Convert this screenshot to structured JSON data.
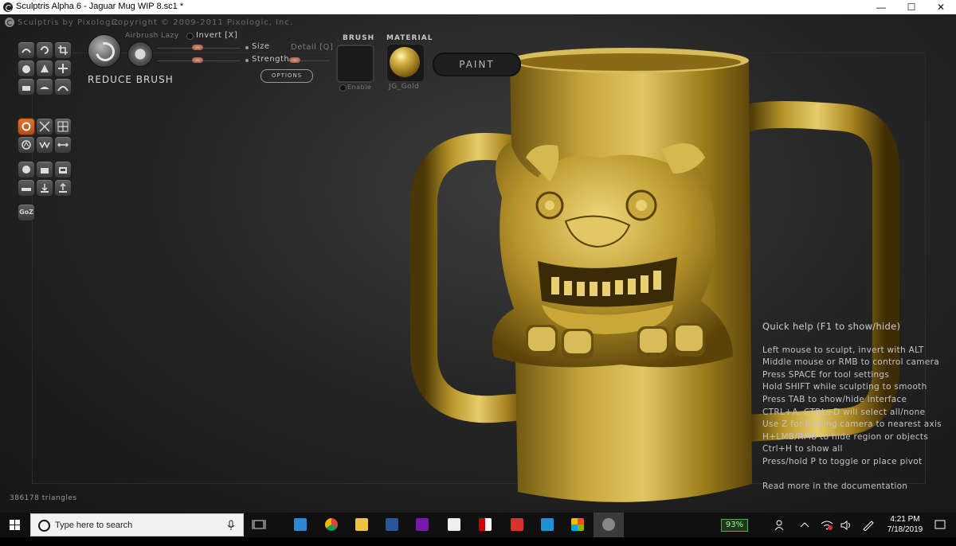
{
  "window": {
    "title": "Sculptris Alpha 6 - Jaguar Mug WIP 8.sc1 *",
    "controls": {
      "minimize": "—",
      "maximize": "☐",
      "close": "✕"
    }
  },
  "app_header": {
    "product": "Sculptris by Pixologic",
    "copyright": "Copyright © 2009-2011 Pixologic, Inc."
  },
  "brush": {
    "name": "REDUCE BRUSH",
    "airbrush_label": "Airbrush",
    "lazy_label": "Lazy",
    "invert_label": "Invert [X]",
    "size_label": "Size",
    "strength_label": "Strength",
    "detail_label": "Detail [Q]",
    "options_label": "OPTIONS"
  },
  "brush_panel": {
    "header": "BRUSH",
    "enable_label": "Enable"
  },
  "material_panel": {
    "header": "MATERIAL",
    "name": "JG_Gold"
  },
  "paint_button": "PAINT",
  "toolbar": {
    "goz_label": "GoZ"
  },
  "quick_help": {
    "title": "Quick help (F1 to show/hide)",
    "lines": [
      "Left mouse to sculpt, invert with ALT",
      "Middle mouse or RMB to control camera",
      "Press SPACE for tool settings",
      "Hold SHIFT while sculpting to smooth",
      "Press TAB to show/hide interface",
      "CTRL+A, CTRL+D will select all/none",
      "Use Z for locking camera to nearest axis",
      "H+LMB/RMB to hide region or objects",
      "Ctrl+H to show all",
      "Press/hold P to toggle or place pivot"
    ],
    "more": "Read more in the documentation"
  },
  "status": {
    "triangles": "386178 triangles"
  },
  "taskbar": {
    "search_placeholder": "Type here to search",
    "battery": "93%",
    "time": "4:21 PM",
    "date": "7/18/2019"
  },
  "colors": {
    "accent_orange": "#d8672a",
    "gold": "#c9a632",
    "taskbar": "#101010"
  }
}
